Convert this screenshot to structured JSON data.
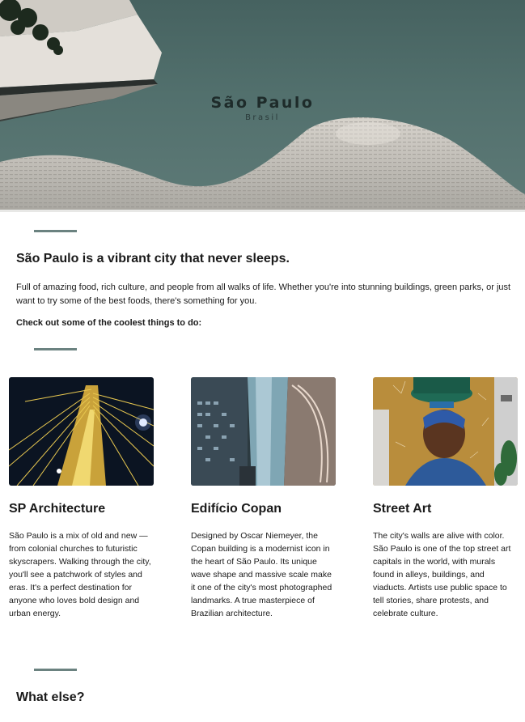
{
  "hero": {
    "title": "São Paulo",
    "subtitle": "Brasil"
  },
  "intro": {
    "heading": "São Paulo is a vibrant city that never sleeps.",
    "body": "Full of amazing food, rich culture, and people from all walks of life. Whether you're into stunning buildings, green parks, or just want to try some of the best foods, there's something for you.",
    "cta": "Check out some of the coolest things to do:"
  },
  "cards": [
    {
      "title": "SP Architecture",
      "text": "São Paulo is a mix of old and new — from colonial churches to futuristic skyscrapers. Walking through the city, you'll see a patchwork of styles and eras. It's a perfect destination for anyone who loves bold design and urban energy."
    },
    {
      "title": "Edifício Copan",
      "text": "Designed by Oscar Niemeyer, the Copan building is a modernist icon in the heart of São Paulo. Its unique wave shape and massive scale make it one of the city's most photographed landmarks. A true masterpiece of Brazilian architecture."
    },
    {
      "title": "Street Art",
      "text": "The city's walls are alive with color. São Paulo is one of the top street art capitals in the world, with murals found in alleys, buildings, and viaducts. Artists use public space to tell stories, share protests, and celebrate culture."
    }
  ],
  "next_section": {
    "heading": "What else?"
  },
  "colors": {
    "accent": "#6b8280",
    "hero_sky": "#4f6d6a",
    "text": "#1a1a1a"
  }
}
